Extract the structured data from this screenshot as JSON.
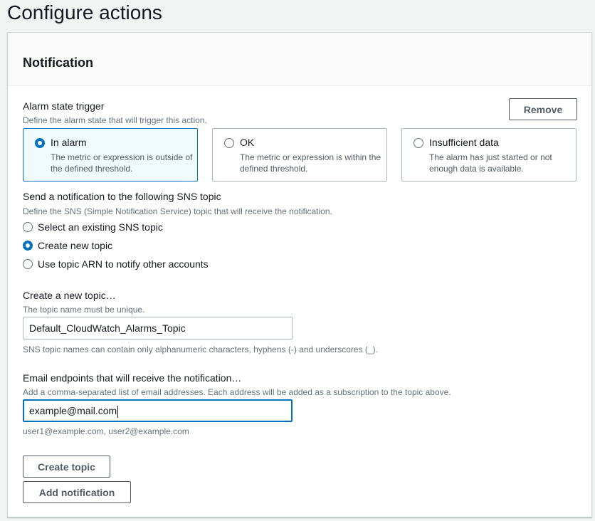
{
  "page_title": "Configure actions",
  "section_title": "Notification",
  "remove_label": "Remove",
  "alarm_state": {
    "label": "Alarm state trigger",
    "description": "Define the alarm state that will trigger this action.",
    "options": [
      {
        "title": "In alarm",
        "description": "The metric or expression is outside of the defined threshold.",
        "selected": true
      },
      {
        "title": "OK",
        "description": "The metric or expression is within the defined threshold.",
        "selected": false
      },
      {
        "title": "Insufficient data",
        "description": "The alarm has just started or not enough data is available.",
        "selected": false
      }
    ]
  },
  "sns": {
    "label": "Send a notification to the following SNS topic",
    "description": "Define the SNS (Simple Notification Service) topic that will receive the notification.",
    "options": [
      {
        "label": "Select an existing SNS topic",
        "selected": false
      },
      {
        "label": "Create new topic",
        "selected": true
      },
      {
        "label": "Use topic ARN to notify other accounts",
        "selected": false
      }
    ]
  },
  "new_topic": {
    "label": "Create a new topic…",
    "description": "The topic name must be unique.",
    "value": "Default_CloudWatch_Alarms_Topic",
    "hint": "SNS topic names can contain only alphanumeric characters, hyphens (-) and underscores (_)."
  },
  "email": {
    "label": "Email endpoints that will receive the notification…",
    "description": "Add a comma-separated list of email addresses. Each address will be added as a subscription to the topic above.",
    "value": "example@mail.com",
    "hint": "user1@example.com, user2@example.com"
  },
  "create_topic_label": "Create topic",
  "add_notification_label": "Add notification",
  "colors": {
    "accent": "#0073bb",
    "selected_bg": "#f1faff"
  }
}
